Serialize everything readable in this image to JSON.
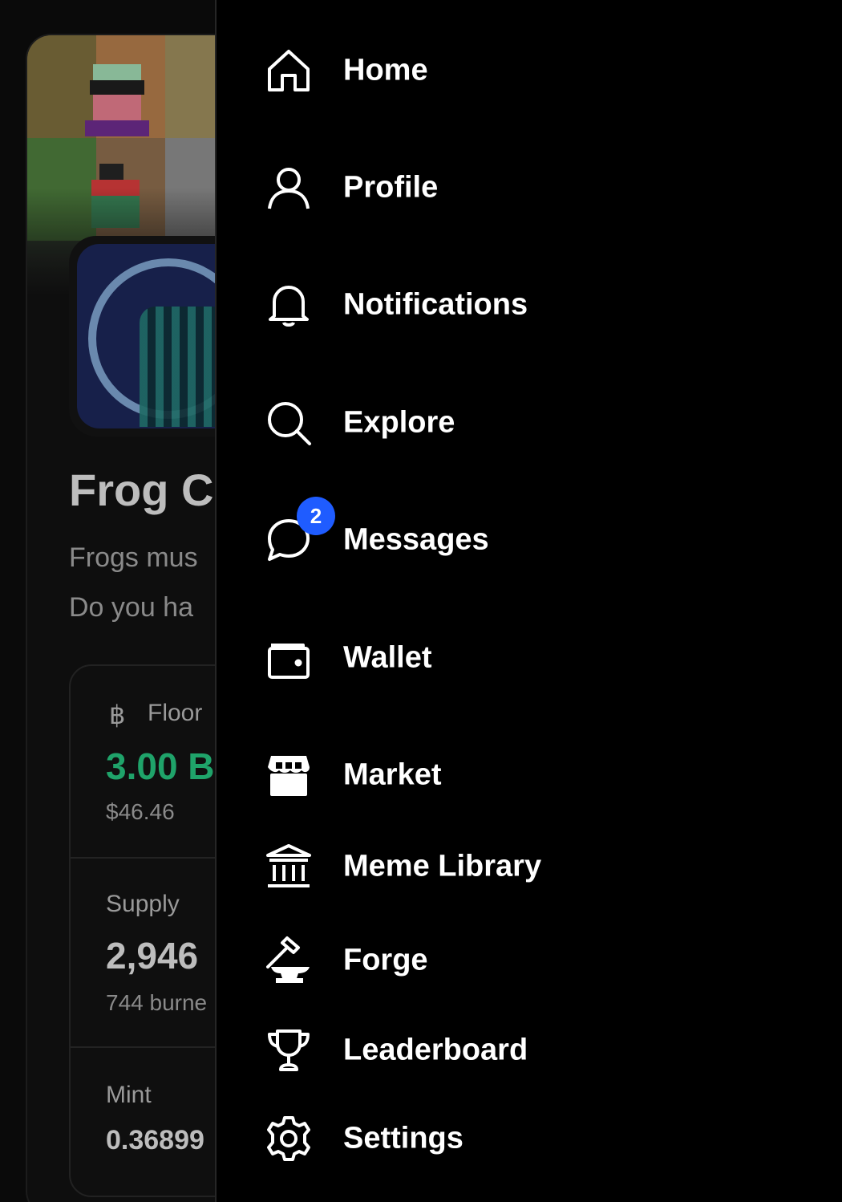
{
  "background": {
    "title": "Frog C",
    "description_lines": [
      "Frogs mus",
      "Do you ha"
    ],
    "stats": {
      "floor": {
        "label": "Floor",
        "value": "3.00 B",
        "sub": "$46.46"
      },
      "supply": {
        "label": "Supply",
        "value": "2,946",
        "sub": "744 burne"
      },
      "mint": {
        "label": "Mint",
        "value": "0.36899"
      }
    },
    "colors": {
      "floor_value": "#1fa36a"
    }
  },
  "menu": {
    "items": [
      {
        "label": "Home",
        "icon": "home-icon"
      },
      {
        "label": "Profile",
        "icon": "user-icon"
      },
      {
        "label": "Notifications",
        "icon": "bell-icon"
      },
      {
        "label": "Explore",
        "icon": "search-icon"
      },
      {
        "label": "Messages",
        "icon": "chat-bubble-icon",
        "badge": "2"
      },
      {
        "label": "Wallet",
        "icon": "wallet-icon"
      },
      {
        "label": "Market",
        "icon": "storefront-icon"
      },
      {
        "label": "Meme Library",
        "icon": "library-building-icon"
      },
      {
        "label": "Forge",
        "icon": "hammer-anvil-icon"
      },
      {
        "label": "Leaderboard",
        "icon": "trophy-icon"
      },
      {
        "label": "Settings",
        "icon": "gear-icon"
      }
    ],
    "badge_color": "#1f5cff"
  }
}
